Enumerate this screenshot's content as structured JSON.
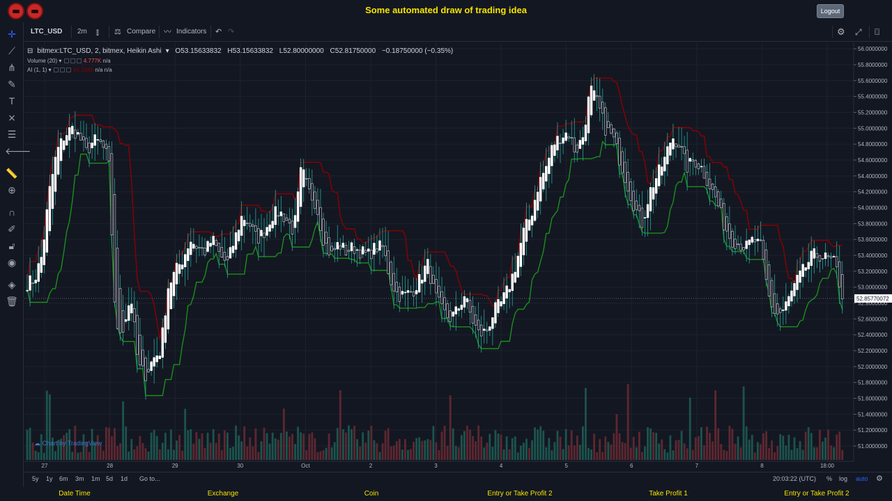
{
  "app": {
    "title": "Some automated draw of trading idea",
    "logout_label": "Logout"
  },
  "left_tools": [
    "crosshair-icon",
    "trend-line-icon",
    "pitchfork-icon",
    "brush-icon",
    "text-icon",
    "pattern-icon",
    "prediction-icon",
    "arrow-left-icon",
    "ruler-icon",
    "zoom-in-icon",
    "magnet-icon",
    "lock-drawing-icon",
    "lock-icon",
    "eye-icon",
    "layers-icon",
    "trash-icon"
  ],
  "toolbar": {
    "symbol": "LTC_USD",
    "interval": "2m",
    "compare_label": "Compare",
    "indicators_label": "Indicators"
  },
  "legend": {
    "series": "bitmex:LTC_USD, 2, bitmex, Heikin Ashi",
    "open": "O53.15633832",
    "high": "H53.15633832",
    "low": "L52.80000000",
    "close": "C52.81750000",
    "change": "−0.18750000 (−0.35%)",
    "volume_label": "Volume (20)",
    "volume_value": "4.777K",
    "volume_na": "n/a",
    "ai_label": "AI (1, 1)",
    "ai_value": "55.3345",
    "ai_na1": "n/a",
    "ai_na2": "n/a"
  },
  "watermark": "Chart by TradingView",
  "chart_data": {
    "type": "candlestick",
    "style": "Heikin Ashi",
    "y_ticks": [
      "56.0000000",
      "55.8000000",
      "55.6000000",
      "55.4000000",
      "55.2000000",
      "55.0000000",
      "54.8000000",
      "54.6000000",
      "54.4000000",
      "54.2000000",
      "54.0000000",
      "53.8000000",
      "53.6000000",
      "53.4000000",
      "53.2000000",
      "53.0000000",
      "52.8000000",
      "52.6000000",
      "52.4000000",
      "52.2000000",
      "52.0000000",
      "51.8000000",
      "51.6000000",
      "51.4000000",
      "51.2000000",
      "51.0000000"
    ],
    "ylim": [
      50.86,
      56.08
    ],
    "last_price": 52.85770072,
    "last_price_label": "52.85770072",
    "x_ticks": [
      "27",
      "28",
      "29",
      "30",
      "Oct",
      "2",
      "3",
      "4",
      "5",
      "6",
      "7",
      "8",
      "18:00"
    ],
    "close_path": [
      53.05,
      53.1,
      53.4,
      54.2,
      54.7,
      54.9,
      55.0,
      54.9,
      54.7,
      54.85,
      54.8,
      54.6,
      52.4,
      52.5,
      52.9,
      52.0,
      51.9,
      52.1,
      52.2,
      53.0,
      53.2,
      53.35,
      53.6,
      53.5,
      53.45,
      53.6,
      53.4,
      53.3,
      53.6,
      53.9,
      53.8,
      53.6,
      53.7,
      53.9,
      53.95,
      53.85,
      53.7,
      54.5,
      54.2,
      54.05,
      53.6,
      53.4,
      53.55,
      53.45,
      53.5,
      53.45,
      53.4,
      53.5,
      53.5,
      53.1,
      52.9,
      52.9,
      52.95,
      53.1,
      53.3,
      52.9,
      52.7,
      52.6,
      52.7,
      52.9,
      52.6,
      52.4,
      52.45,
      52.7,
      52.8,
      53.0,
      53.3,
      53.7,
      53.9,
      54.3,
      54.5,
      54.8,
      54.9,
      54.95,
      54.7,
      54.9,
      55.5,
      55.3,
      55.0,
      54.9,
      54.6,
      54.3,
      54.0,
      53.8,
      54.2,
      54.4,
      54.6,
      54.9,
      54.8,
      54.5,
      54.6,
      54.5,
      54.3,
      54.1,
      53.8,
      53.6,
      53.55,
      53.5,
      53.6,
      53.5,
      52.9,
      52.65,
      52.7,
      52.9,
      53.1,
      53.25,
      53.4,
      53.4,
      53.35,
      53.3,
      52.9
    ]
  },
  "bottombar": {
    "ranges": [
      "5y",
      "1y",
      "6m",
      "3m",
      "1m",
      "5d",
      "1d"
    ],
    "goto_label": "Go to...",
    "time": "20:03:22 (UTC)",
    "percent": "%",
    "log": "log",
    "auto": "auto"
  },
  "footer": [
    "Date Time",
    "Exchange",
    "Coin",
    "Entry or Take Profit 2",
    "Take Profit 1",
    "Entry or Take Profit 2"
  ],
  "colors": {
    "up": "#26a69a",
    "down": "#ef5350",
    "upper_line": "#8b0000",
    "lower_line": "#1b8f1b",
    "accent": "#f5e400"
  }
}
